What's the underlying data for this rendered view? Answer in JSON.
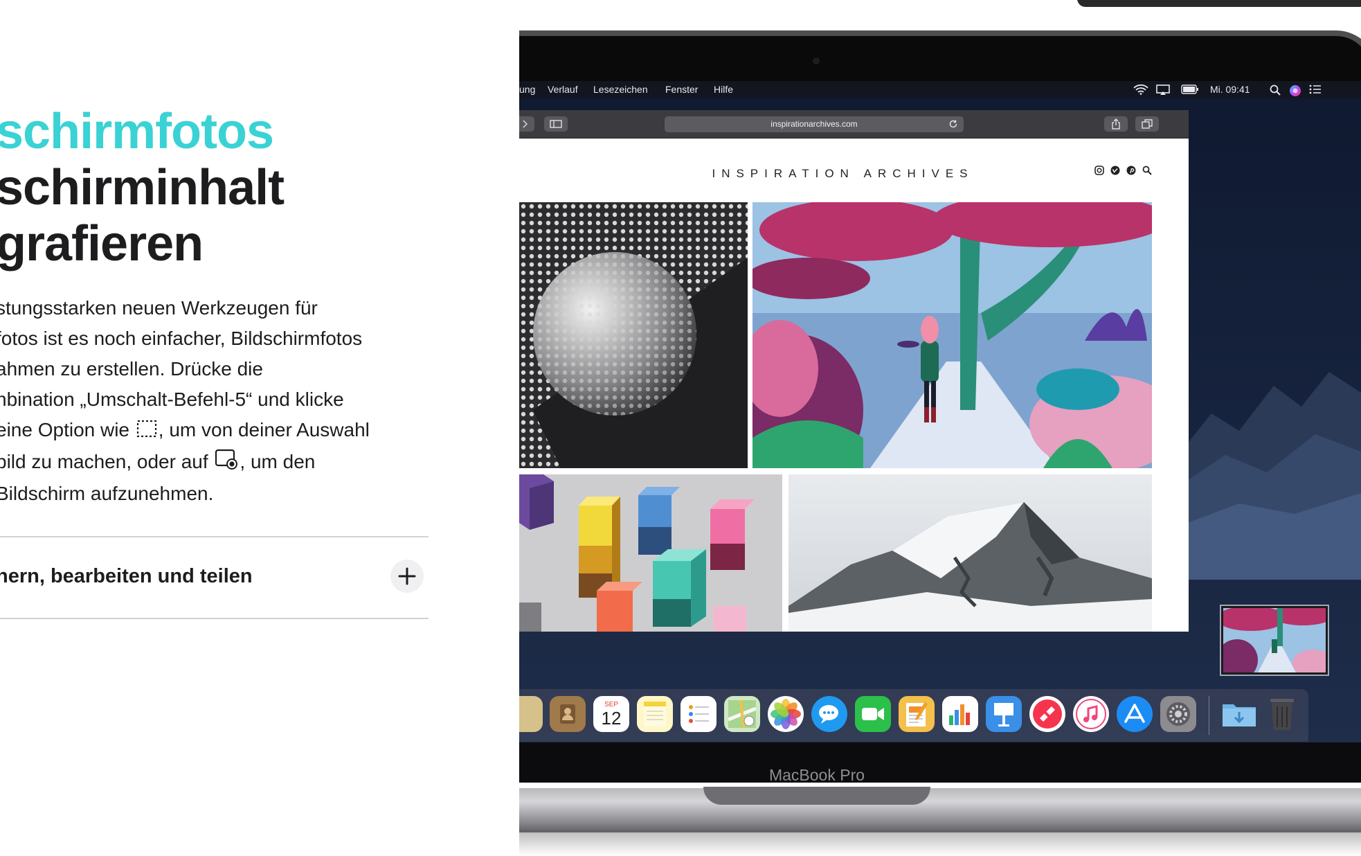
{
  "headline": {
    "line1": "schirmfotos",
    "line2": "schirminhalt",
    "line3": "grafieren"
  },
  "body_lines": [
    "stungsstarken neuen Werkzeugen für",
    "fotos ist es noch einfacher, Bildschirmfotos",
    "ahmen zu erstellen. Drücke die",
    "nbination „Umschalt-Befehl-5“ und klicke"
  ],
  "body_line5": {
    "before": "eine Option wie ",
    "after": ", um von deiner Auswahl"
  },
  "body_line6": {
    "before": "bild zu machen, oder auf ",
    "after": ", um den"
  },
  "body_line7": "Bildschirm aufzunehmen.",
  "accordion": {
    "label": "hern, bearbeiten und teilen"
  },
  "menubar": {
    "items": [
      "ung",
      "Verlauf",
      "Lesezeichen",
      "Fenster",
      "Hilfe"
    ],
    "clock": "Mi. 09:41"
  },
  "browser": {
    "url": "inspirationarchives.com",
    "site_title": "INSPIRATION ARCHIVES"
  },
  "dock": {
    "calendar_month": "SEP",
    "calendar_day": "12"
  },
  "laptop": {
    "label": "MacBook Pro"
  },
  "colors": {
    "accent": "#3ad2d4",
    "text": "#1d1d1f",
    "divider": "#d2d2d7"
  }
}
